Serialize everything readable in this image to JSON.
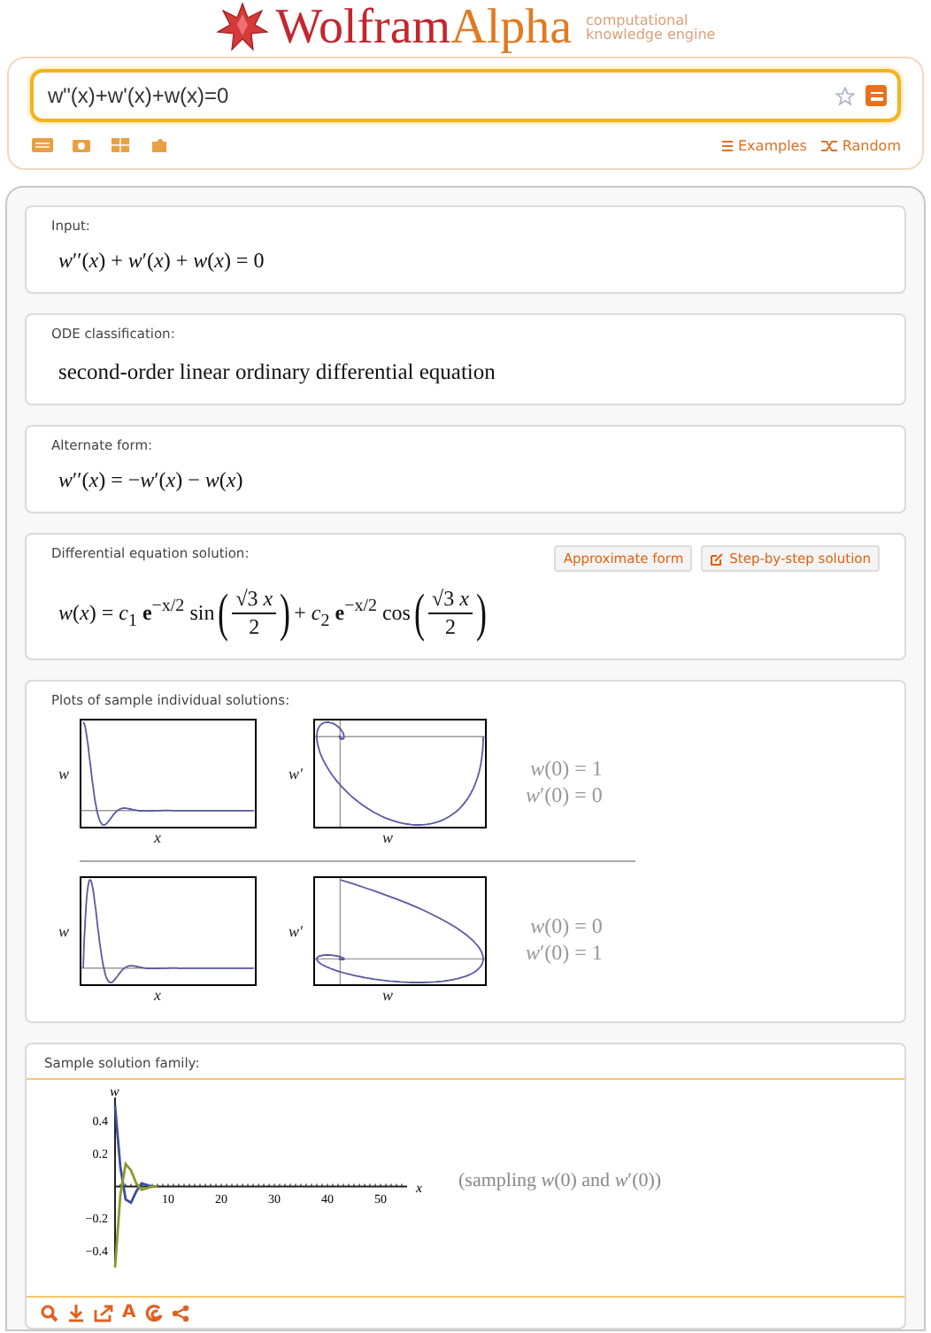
{
  "logo": {
    "part1": "Wolfram",
    "part2": "Alpha",
    "tagline": [
      "computational",
      "knowledge engine"
    ]
  },
  "search": {
    "value": "w\"(x)+w'(x)+w(x)=0"
  },
  "links": [
    "Examples",
    "Random"
  ],
  "pods": [
    {
      "kind": "math",
      "title": "Input:",
      "parts": [
        {
          "kind": "text",
          "text": "*w*′′(*x*) + *w*′(*x*) + *w*(*x*) = 0"
        }
      ]
    },
    {
      "kind": "text",
      "title": "ODE classification:",
      "parts": [
        {
          "kind": "text",
          "text": "second-order linear ordinary differential equation"
        }
      ]
    },
    {
      "kind": "math",
      "title": "Alternate form:",
      "parts": [
        {
          "kind": "text",
          "text": "*w*′′(*x*) = −*w*′(*x*) − *w*(*x*)"
        }
      ]
    },
    {
      "kind": "math",
      "title": "Differential equation solution:",
      "buttons": [
        "Approximate form",
        "Step-by-step solution"
      ],
      "parts": [
        {
          "kind": "text",
          "text": "*w*(*x*) = *c*$_{1}$ **e**$^{−x/2}$ sin"
        },
        {
          "kind": "frac",
          "open": "(",
          "num": "√3 *x*",
          "den": "2",
          "close": ")"
        },
        {
          "kind": "text",
          "text": "+ *c*$_{2}$ **e**$^{−x/2}$ cos"
        },
        {
          "kind": "frac",
          "open": "(",
          "num": "√3 *x*",
          "den": "2",
          "close": ")"
        }
      ]
    },
    {
      "kind": "plots",
      "title": "Plots of sample individual solutions:",
      "rows": [
        {
          "time_axes": {
            "y": "w",
            "x": "x"
          },
          "phase_axes": {
            "y": "w′",
            "x": "w"
          },
          "conditions": [
            "*w*(0) = 1",
            "*w*′(0) = 0"
          ]
        },
        {
          "time_axes": {
            "y": "w",
            "x": "x"
          },
          "phase_axes": {
            "y": "w′",
            "x": "w"
          },
          "conditions": [
            "*w*(0) = 0",
            "*w*′(0) = 1"
          ]
        }
      ]
    },
    {
      "kind": "family",
      "title": "Sample solution family:",
      "caption": "(sampling *w*(0) and *w*′(0))",
      "tools": [
        "A"
      ],
      "chart_data": {
        "type": "line",
        "xlabel": "x",
        "ylabel": "w",
        "x": [
          0,
          1,
          2,
          3,
          4,
          5,
          6,
          7,
          8
        ],
        "xlim": [
          0,
          55
        ],
        "ylim": [
          -0.5,
          0.55
        ],
        "xticks": [
          10,
          20,
          30,
          40,
          50
        ],
        "yticks": [
          {
            "value": -0.4,
            "label": "−0.4"
          },
          {
            "value": -0.2,
            "label": "−0.2"
          },
          {
            "value": 0.2,
            "label": "0.2"
          },
          {
            "value": 0.4,
            "label": "0.4"
          }
        ],
        "series": [
          {
            "color": "#3b4f9a",
            "values": [
              0.5,
              0.12,
              -0.08,
              -0.1,
              -0.03,
              0.02,
              0.01,
              0,
              0
            ]
          },
          {
            "color": "#8a9a2a",
            "values": [
              -0.5,
              -0.05,
              0.14,
              0.1,
              0.02,
              -0.02,
              -0.01,
              0,
              0
            ]
          }
        ]
      }
    }
  ]
}
